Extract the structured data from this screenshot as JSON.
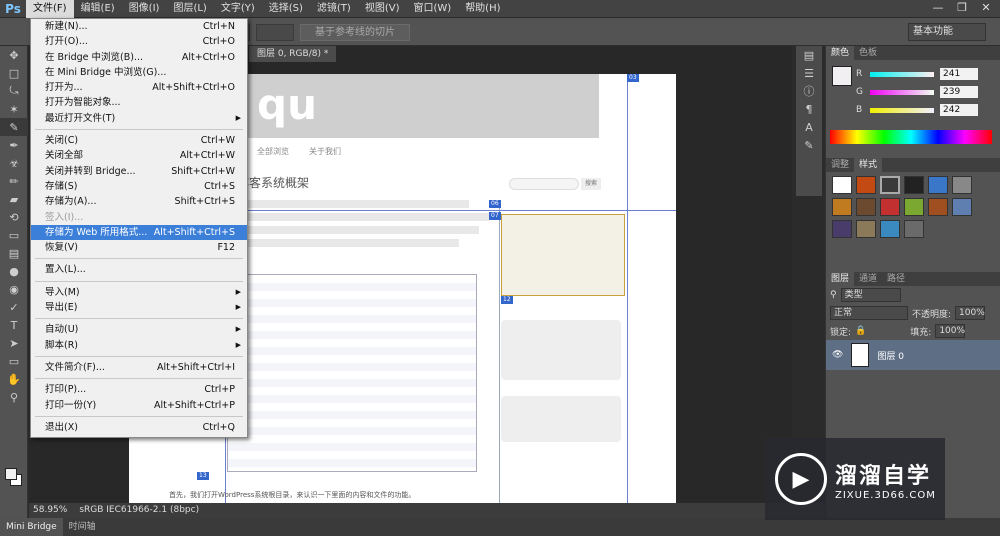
{
  "app": {
    "logo": "Ps"
  },
  "menubar": {
    "items": [
      {
        "label": "文件(F)"
      },
      {
        "label": "编辑(E)"
      },
      {
        "label": "图像(I)"
      },
      {
        "label": "图层(L)"
      },
      {
        "label": "文字(Y)"
      },
      {
        "label": "选择(S)"
      },
      {
        "label": "滤镜(T)"
      },
      {
        "label": "视图(V)"
      },
      {
        "label": "窗口(W)"
      },
      {
        "label": "帮助(H)"
      }
    ]
  },
  "optionsbar": {
    "slice_button": "基于参考线的切片",
    "workspace": "基本功能"
  },
  "document": {
    "tab_title": "图层 0, RGB/8) *"
  },
  "canvas": {
    "logo_text": "qu",
    "nav": [
      "全部浏览",
      "关于我们"
    ],
    "title": "博客系统概架",
    "search_btn": "搜索",
    "footer_text": "首先，我们打开WordPress系统根目录，来认识一下里面的内容和文件的功能。"
  },
  "file_menu": {
    "items": [
      {
        "label": "新建(N)...",
        "shortcut": "Ctrl+N"
      },
      {
        "label": "打开(O)...",
        "shortcut": "Ctrl+O"
      },
      {
        "label": "在 Bridge 中浏览(B)...",
        "shortcut": "Alt+Ctrl+O"
      },
      {
        "label": "在 Mini Bridge 中浏览(G)...",
        "shortcut": ""
      },
      {
        "label": "打开为...",
        "shortcut": "Alt+Shift+Ctrl+O"
      },
      {
        "label": "打开为智能对象...",
        "shortcut": ""
      },
      {
        "label": "最近打开文件(T)",
        "shortcut": "",
        "submenu": true
      },
      {
        "sep": true
      },
      {
        "label": "关闭(C)",
        "shortcut": "Ctrl+W"
      },
      {
        "label": "关闭全部",
        "shortcut": "Alt+Ctrl+W"
      },
      {
        "label": "关闭并转到 Bridge...",
        "shortcut": "Shift+Ctrl+W"
      },
      {
        "label": "存储(S)",
        "shortcut": "Ctrl+S"
      },
      {
        "label": "存储为(A)...",
        "shortcut": "Shift+Ctrl+S"
      },
      {
        "label": "签入(I)...",
        "shortcut": "",
        "disabled": true
      },
      {
        "label": "存储为 Web 所用格式...",
        "shortcut": "Alt+Shift+Ctrl+S",
        "highlight": true
      },
      {
        "label": "恢复(V)",
        "shortcut": "F12"
      },
      {
        "sep": true
      },
      {
        "label": "置入(L)...",
        "shortcut": ""
      },
      {
        "sep": true
      },
      {
        "label": "导入(M)",
        "shortcut": "",
        "submenu": true
      },
      {
        "label": "导出(E)",
        "shortcut": "",
        "submenu": true
      },
      {
        "sep": true
      },
      {
        "label": "自动(U)",
        "shortcut": "",
        "submenu": true
      },
      {
        "label": "脚本(R)",
        "shortcut": "",
        "submenu": true
      },
      {
        "sep": true
      },
      {
        "label": "文件简介(F)...",
        "shortcut": "Alt+Shift+Ctrl+I"
      },
      {
        "sep": true
      },
      {
        "label": "打印(P)...",
        "shortcut": "Ctrl+P"
      },
      {
        "label": "打印一份(Y)",
        "shortcut": "Alt+Shift+Ctrl+P"
      },
      {
        "sep": true
      },
      {
        "label": "退出(X)",
        "shortcut": "Ctrl+Q"
      }
    ]
  },
  "color_panel": {
    "tabs": [
      "颜色",
      "色板"
    ],
    "r": {
      "label": "R",
      "value": "241"
    },
    "g": {
      "label": "G",
      "value": "239"
    },
    "b": {
      "label": "B",
      "value": "242"
    }
  },
  "styles_panel": {
    "tabs": [
      "调整",
      "样式"
    ]
  },
  "layers_panel": {
    "tabs": [
      "图层",
      "通道",
      "路径"
    ],
    "kind": "类型",
    "blend_mode": "正常",
    "opacity_label": "不透明度:",
    "opacity": "100%",
    "lock_label": "锁定:",
    "fill_label": "填充:",
    "fill": "100%",
    "layer_name": "图层 0"
  },
  "statusbar": {
    "zoom": "58.95%",
    "profile": "sRGB IEC61966-2.1 (8bpc)"
  },
  "bottom_tabs": [
    "Mini Bridge",
    "时间轴"
  ],
  "watermark": {
    "title": "溜溜自学",
    "sub": "ZIXUE.3D66.COM"
  }
}
